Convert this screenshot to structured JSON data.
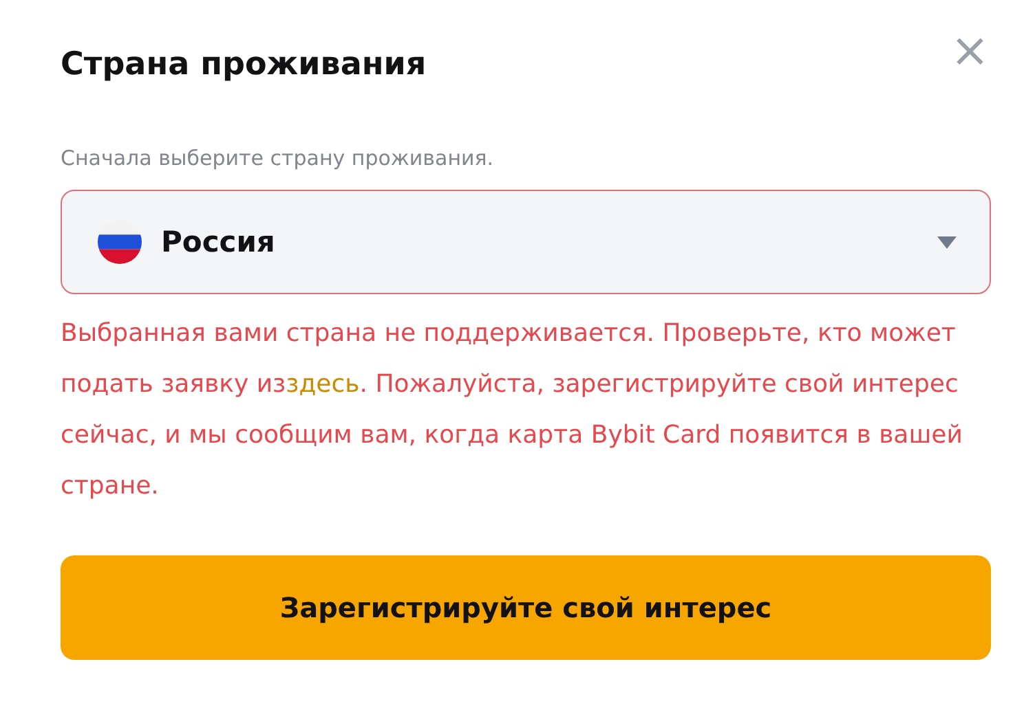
{
  "dialog": {
    "title": "Страна проживания",
    "close": "×"
  },
  "country": {
    "label": "Сначала выберите страну проживания.",
    "value": "Россия",
    "invalid": true
  },
  "error": {
    "before": "Выбранная вами страна не поддерживается. Проверьте, кто может подать заявку из",
    "link": "здесь",
    "after": ". Пожалуйста, зарегистрируйте свой интерес сейчас, и мы сообщим вам, когда карта Bybit Card появится в вашей стране."
  },
  "button": "Зарегистрируйте свой интерес"
}
